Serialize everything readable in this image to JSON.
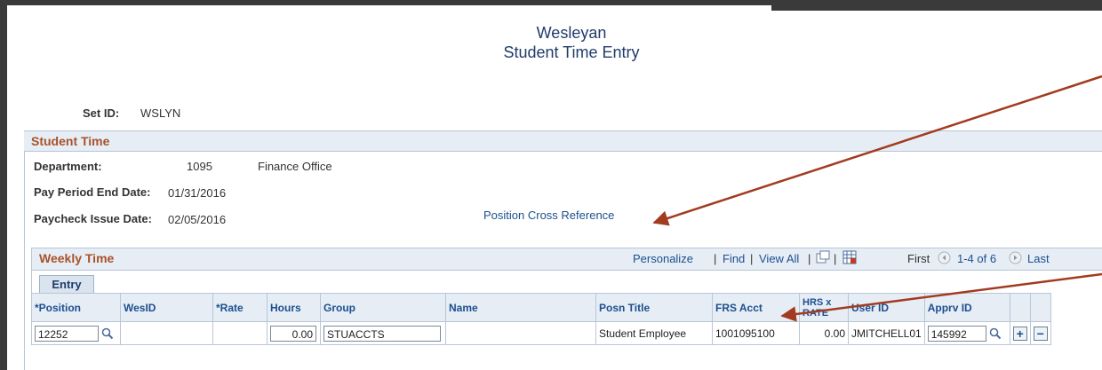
{
  "header": {
    "line1": "Wesleyan",
    "line2": "Student Time Entry"
  },
  "setid": {
    "label": "Set ID:",
    "value": "WSLYN"
  },
  "student_time": {
    "title": "Student Time",
    "department_label": "Department:",
    "department_code": "1095",
    "department_name": "Finance Office",
    "pay_period_label": "Pay Period End Date:",
    "pay_period_value": "01/31/2016",
    "paycheck_label": "Paycheck Issue Date:",
    "paycheck_value": "02/05/2016",
    "position_xref_link": "Position Cross Reference"
  },
  "weekly_time": {
    "title": "Weekly Time",
    "personalize": "Personalize",
    "sep1": "|",
    "find": "Find",
    "sep2": "|",
    "view_all": "View All",
    "sep3": "|",
    "sep4": "|",
    "first": "First",
    "range": "1-4 of 6",
    "last": "Last",
    "tab": "Entry",
    "columns": [
      "*Position",
      "WesID",
      "*Rate",
      "Hours",
      "Group",
      "Name",
      "Posn Title",
      "FRS Acct",
      "HRS x RATE",
      "User ID",
      "Apprv ID"
    ],
    "row": {
      "position": "12252",
      "wesid": "",
      "rate": "",
      "hours": "0.00",
      "group": "STUACCTS",
      "name": "",
      "posn_title": "Student Employee",
      "frs_acct": "1001095100",
      "hrs_rate": "0.00",
      "user_id": "JMITCHELL01",
      "apprv_id": "145992"
    }
  },
  "colors": {
    "accent": "#a8522a",
    "link": "#1c4f8f",
    "annotation_arrow": "#a23b1f"
  }
}
